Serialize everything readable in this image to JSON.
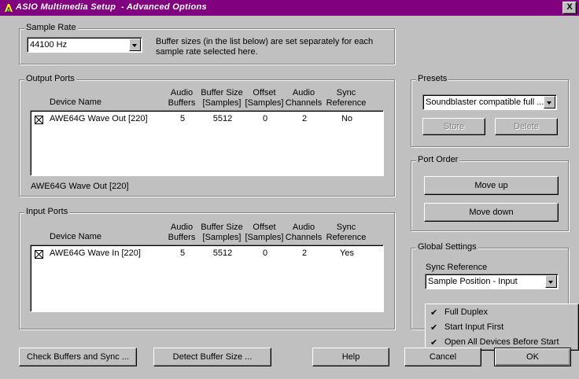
{
  "window": {
    "title": "ASIO Multimedia Setup  - Advanced Options",
    "close_symbol": "X"
  },
  "sample_rate": {
    "legend": "Sample Rate",
    "selected": "44100 Hz",
    "note_line1": "Buffer sizes (in the list below) are set separately for each",
    "note_line2": "sample rate selected here."
  },
  "columns": {
    "device": "Device Name",
    "buffers": [
      "Audio",
      "Buffers"
    ],
    "buffer_size": [
      "Buffer Size",
      "[Samples]"
    ],
    "offset": [
      "Offset",
      "[Samples]"
    ],
    "channels": [
      "Audio",
      "Channels"
    ],
    "sync": [
      "Sync",
      "Reference"
    ]
  },
  "output_ports": {
    "legend": "Output Ports",
    "rows": [
      {
        "name": "AWE64G Wave Out [220]",
        "buffers": "5",
        "buffer_size": "5512",
        "offset": "0",
        "channels": "2",
        "sync": "No"
      }
    ],
    "status": "AWE64G Wave Out [220]"
  },
  "input_ports": {
    "legend": "Input Ports",
    "rows": [
      {
        "name": "AWE64G Wave In [220]",
        "buffers": "5",
        "buffer_size": "5512",
        "offset": "0",
        "channels": "2",
        "sync": "Yes"
      }
    ]
  },
  "presets": {
    "legend": "Presets",
    "selected": "Soundblaster compatible full ...",
    "store_label": "Store",
    "delete_label": "Delete"
  },
  "port_order": {
    "legend": "Port Order",
    "move_up_label": "Move up",
    "move_down_label": "Move down"
  },
  "global_settings": {
    "legend": "Global Settings",
    "sync_reference_label": "Sync Reference",
    "sync_reference_selected": "Sample Position - Input"
  },
  "options_menu": {
    "items": [
      {
        "label": "Full Duplex",
        "checked": true
      },
      {
        "label": "Start Input First",
        "checked": true
      },
      {
        "label": "Open All Devices Before Start",
        "checked": true
      }
    ],
    "check_glyph": "✔"
  },
  "footer": {
    "check_buffers_label": "Check Buffers and Sync ...",
    "detect_buffer_label": "Detect Buffer Size ...",
    "help_label": "Help",
    "cancel_label": "Cancel",
    "ok_label": "OK"
  },
  "colors": {
    "titlebar": "#800080",
    "face": "#c0c0c0"
  }
}
